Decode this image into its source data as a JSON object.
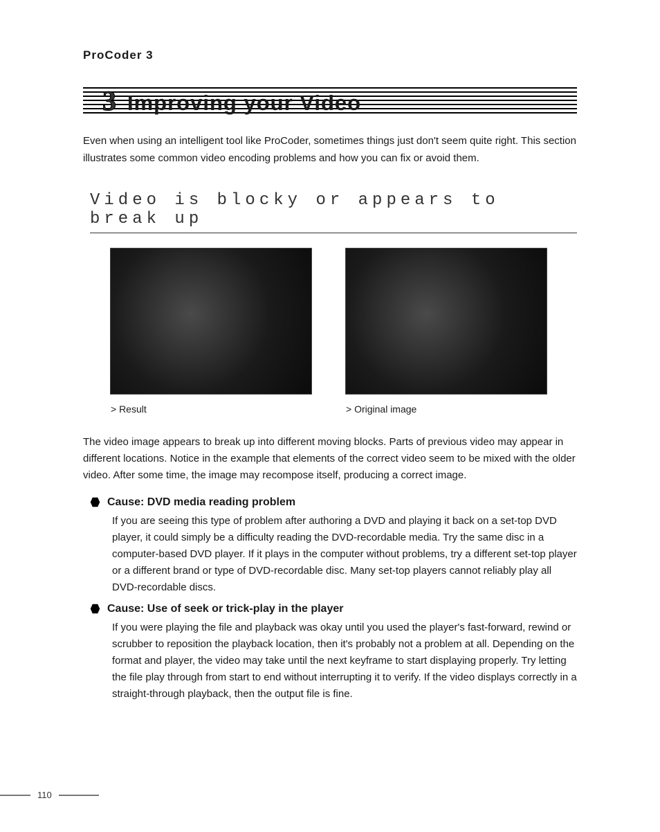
{
  "header": {
    "running_title": "ProCoder 3"
  },
  "chapter": {
    "number": "3",
    "title": "Improving your Video",
    "intro": "Even when using an intelligent tool like ProCoder, sometimes things just don't seem quite right. This section illustrates some common video encoding problems and how you can fix or avoid them."
  },
  "section": {
    "title": "Video is blocky or appears to break up",
    "figure_left_caption": "> Result",
    "figure_right_caption": "> Original image",
    "description": "The video image appears to break up into different moving blocks. Parts of previous video may appear in different locations. Notice in the example that elements of the correct video seem to be mixed with the older video. After some time, the image may recompose itself, producing a correct image.",
    "causes": [
      {
        "title": "Cause: DVD media reading problem",
        "body": "If you are seeing this type of problem after authoring a DVD and playing it back on a set-top DVD player, it could simply be a difficulty reading the DVD-recordable media. Try the same disc in a computer-based DVD player. If it plays in the computer without problems, try a different set-top player or a different brand or type of DVD-recordable disc. Many set-top players cannot reliably play all DVD-recordable discs."
      },
      {
        "title": "Cause: Use of seek or trick-play in the player",
        "body": "If you were playing the file and playback was okay until you used the player's fast-forward, rewind or scrubber to reposition the playback location, then it's probably not a problem at all. Depending on the format and player, the video may take until the next keyframe to start displaying properly. Try letting the file play through from start to end without interrupting it to verify. If the video displays correctly in a straight-through playback, then the output file is fine."
      }
    ]
  },
  "footer": {
    "page_number": "110"
  }
}
